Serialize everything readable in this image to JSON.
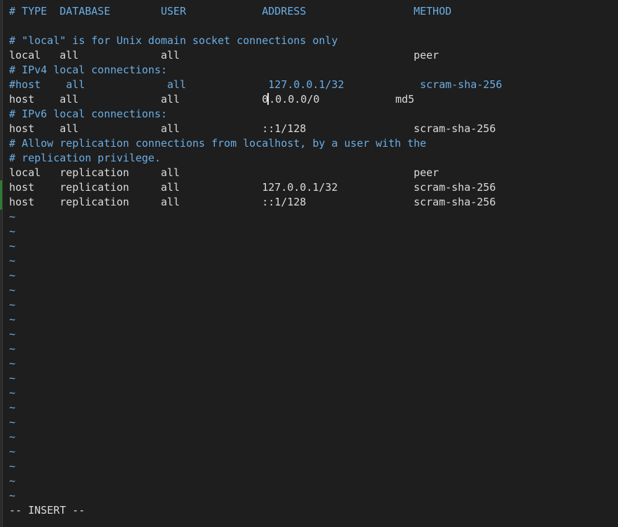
{
  "editor": {
    "lines": [
      {
        "text": "# TYPE  DATABASE        USER            ADDRESS                 METHOD",
        "kind": "comment"
      },
      {
        "text": "",
        "kind": "text"
      },
      {
        "text": "# \"local\" is for Unix domain socket connections only",
        "kind": "comment"
      },
      {
        "text": "local   all             all                                     peer",
        "kind": "text"
      },
      {
        "text": "# IPv4 local connections:",
        "kind": "comment"
      },
      {
        "text": "#host    all             all             127.0.0.1/32            scram-sha-256",
        "kind": "comment"
      },
      {
        "text_before_cursor": "host    all             all             0",
        "text_after_cursor": ".0.0.0/0            md5",
        "kind": "cursor"
      },
      {
        "text": "# IPv6 local connections:",
        "kind": "comment"
      },
      {
        "text": "host    all             all             ::1/128                 scram-sha-256",
        "kind": "text"
      },
      {
        "text": "# Allow replication connections from localhost, by a user with the",
        "kind": "comment"
      },
      {
        "text": "# replication privilege.",
        "kind": "comment"
      },
      {
        "text": "local   replication     all                                     peer",
        "kind": "text"
      },
      {
        "text": "host    replication     all             127.0.0.1/32            scram-sha-256",
        "kind": "text"
      },
      {
        "text": "host    replication     all             ::1/128                 scram-sha-256",
        "kind": "text"
      }
    ],
    "empty_line_marker": "~",
    "empty_line_count": 20
  },
  "status": {
    "mode": "-- INSERT --"
  },
  "colors": {
    "background": "#1e1e1e",
    "comment": "#6aaee6",
    "text": "#dcdcdc",
    "tilde": "#6aaee6"
  }
}
